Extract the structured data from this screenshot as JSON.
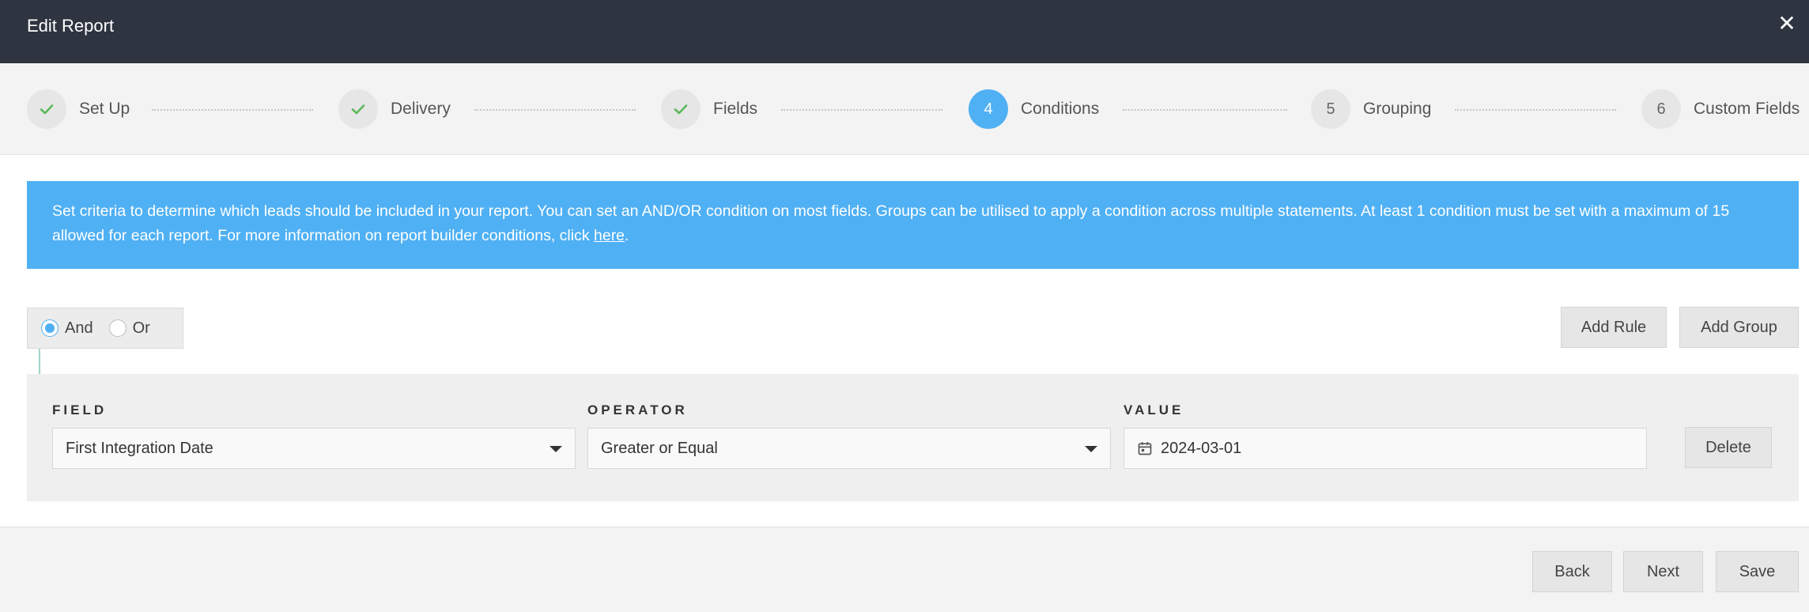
{
  "header": {
    "title": "Edit Report",
    "close_glyph": "✕"
  },
  "stepper": {
    "steps": [
      {
        "number": "",
        "label": "Set Up",
        "state": "completed",
        "icon": "check-icon"
      },
      {
        "number": "",
        "label": "Delivery",
        "state": "completed",
        "icon": "check-icon"
      },
      {
        "number": "",
        "label": "Fields",
        "state": "completed",
        "icon": "check-icon"
      },
      {
        "number": "4",
        "label": "Conditions",
        "state": "active"
      },
      {
        "number": "5",
        "label": "Grouping",
        "state": "pending"
      },
      {
        "number": "6",
        "label": "Custom Fields",
        "state": "pending"
      }
    ]
  },
  "info": {
    "text_before_link": "Set criteria to determine which leads should be included in your report. You can set an AND/OR condition on most fields. Groups can be utilised to apply a condition across multiple statements. At least 1 condition must be set with a maximum of 15 allowed for each report. For more information on report builder conditions, click ",
    "link": "here",
    "text_after_link": "."
  },
  "logic": {
    "and_label": "And",
    "or_label": "Or",
    "selected": "And"
  },
  "actions": {
    "add_rule": "Add Rule",
    "add_group": "Add Group"
  },
  "rule": {
    "field_label": "FIELD",
    "field_value": "First Integration Date",
    "operator_label": "OPERATOR",
    "operator_value": "Greater or Equal",
    "value_label": "VALUE",
    "value_value": "2024-03-01",
    "delete": "Delete"
  },
  "footer": {
    "back": "Back",
    "next": "Next",
    "save": "Save"
  },
  "colors": {
    "header_bg": "#2e3440",
    "accent": "#4fb0f4",
    "check": "#5cb85c"
  }
}
